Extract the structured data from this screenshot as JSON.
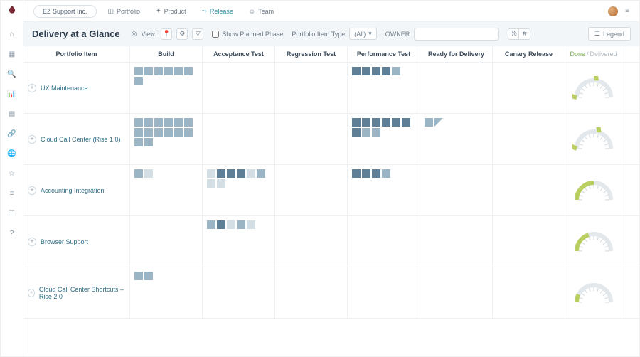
{
  "org": {
    "name": "EZ Support Inc."
  },
  "nav": {
    "portfolio": "Portfolio",
    "product": "Product",
    "release": "Release",
    "team": "Team"
  },
  "toolbar": {
    "title": "Delivery at a Glance",
    "view_label": "View:",
    "show_planned_phase": "Show Planned Phase",
    "portfolio_item_type_label": "Portfolio Item Type",
    "portfolio_item_type_value": "(All)",
    "owner_label": "OWNER",
    "legend": "Legend"
  },
  "columns": {
    "item": "Portfolio Item",
    "build": "Build",
    "acceptance": "Acceptance Test",
    "regression": "Regression Test",
    "performance": "Performance Test",
    "ready": "Ready for Delivery",
    "canary": "Canary Release",
    "gauge_done": "Done",
    "gauge_sep": "/",
    "gauge_delivered": "Delivered"
  },
  "rows": [
    {
      "name": "UX Maintenance",
      "build": [
        "mid",
        "mid",
        "mid",
        "mid",
        "mid",
        "mid",
        "mid"
      ],
      "acceptance": [],
      "regression": [],
      "performance": [
        "dark",
        "dark",
        "dark",
        "dark",
        "mid"
      ],
      "ready": [],
      "canary": [],
      "gauge": {
        "done_pct": 55,
        "delivered_pct": 10
      }
    },
    {
      "name": "Cloud Call Center (Rise 1.0)",
      "build": [
        "mid",
        "mid",
        "mid",
        "mid",
        "mid",
        "mid",
        "mid",
        "mid",
        "mid",
        "mid",
        "mid",
        "mid",
        "mid",
        "mid"
      ],
      "acceptance": [],
      "regression": [],
      "performance": [
        "dark",
        "dark",
        "dark",
        "dark",
        "dark",
        "dark",
        "dark",
        "mid",
        "mid"
      ],
      "ready": [
        "mid",
        "tri"
      ],
      "canary": [],
      "gauge": {
        "done_pct": 60,
        "delivered_pct": 12
      }
    },
    {
      "name": "Accounting Integration",
      "build": [
        "mid",
        "light"
      ],
      "acceptance": [
        "light",
        "dark",
        "dark",
        "dark",
        "light",
        "mid",
        "light",
        "light"
      ],
      "regression": [],
      "performance": [
        "dark",
        "dark",
        "dark",
        "mid"
      ],
      "ready": [],
      "canary": [],
      "gauge": {
        "done_pct": 50,
        "delivered_pct": 8
      }
    },
    {
      "name": "Browser Support",
      "build": [],
      "acceptance": [
        "mid",
        "dark",
        "light",
        "mid",
        "light"
      ],
      "regression": [],
      "performance": [],
      "ready": [],
      "canary": [],
      "gauge": {
        "done_pct": 40,
        "delivered_pct": 5
      }
    },
    {
      "name": "Cloud Call Center Shortcuts – Rise 2.0",
      "build": [
        "mid",
        "mid"
      ],
      "acceptance": [],
      "regression": [],
      "performance": [],
      "ready": [],
      "canary": [],
      "gauge": {
        "done_pct": 15,
        "delivered_pct": 2
      }
    }
  ],
  "rail_icons": [
    "home",
    "grid",
    "search",
    "chart",
    "layers",
    "link",
    "globe",
    "star",
    "bars",
    "list",
    "help"
  ]
}
